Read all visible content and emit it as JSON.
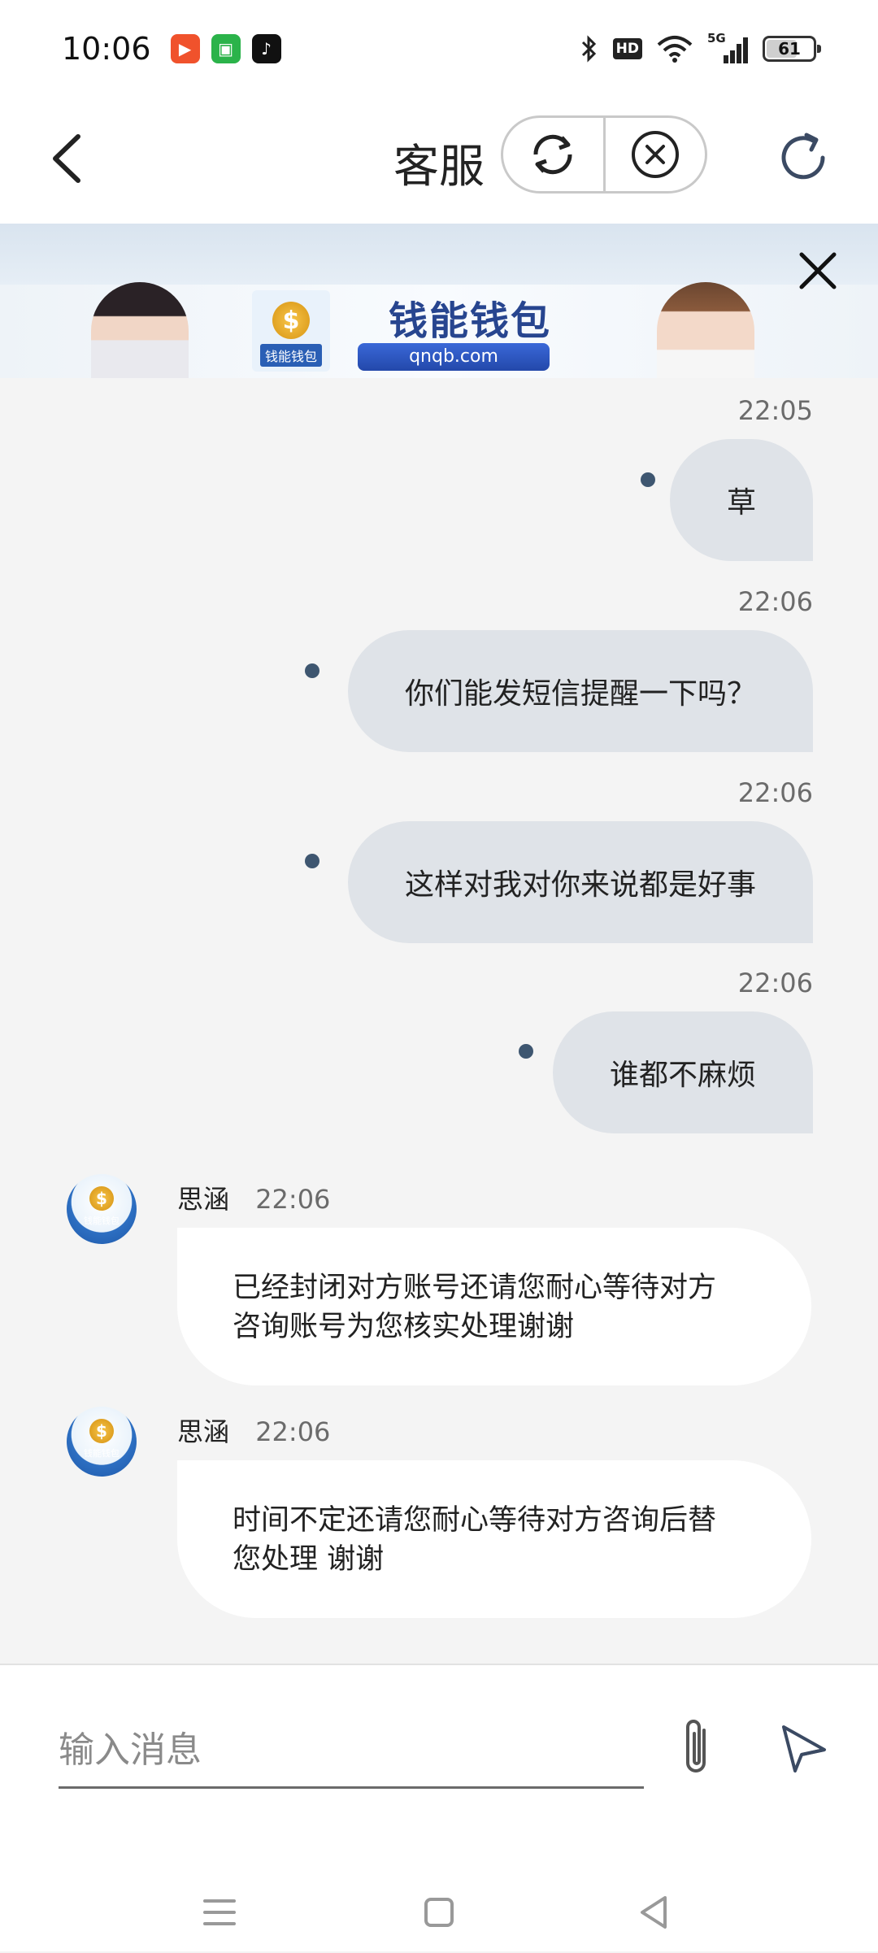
{
  "status_bar": {
    "time": "10:06",
    "battery": "61",
    "network": "5G",
    "hd": "HD"
  },
  "header": {
    "title": "客服"
  },
  "banner": {
    "brand": "钱能钱包",
    "url": "qnqb.com",
    "logo_text": "钱能钱包"
  },
  "messages": [
    {
      "dir": "out",
      "time": "22:05",
      "text": "草"
    },
    {
      "dir": "out",
      "time": "22:06",
      "text": "你们能发短信提醒一下吗？"
    },
    {
      "dir": "out",
      "time": "22:06",
      "text": "这样对我对你来说都是好事"
    },
    {
      "dir": "out",
      "time": "22:06",
      "text": "谁都不麻烦"
    },
    {
      "dir": "in",
      "sender": "思涵",
      "time": "22:06",
      "text_line1": "已经封闭对方账号还请您耐心等待对方",
      "text_line2": "咨询账号为您核实处理谢谢"
    },
    {
      "dir": "in",
      "sender": "思涵",
      "time": "22:06",
      "text_line1": "时间不定还请您耐心等待对方咨询后替",
      "text_line2": "您处理 谢谢"
    }
  ],
  "avatar_text": "钱能钱包",
  "input": {
    "placeholder": "输入消息"
  },
  "colors": {
    "out_bubble": "#dfe3e8",
    "in_bubble": "#ffffff",
    "unread_dot": "#3e5670",
    "brand_blue": "#27458f"
  }
}
